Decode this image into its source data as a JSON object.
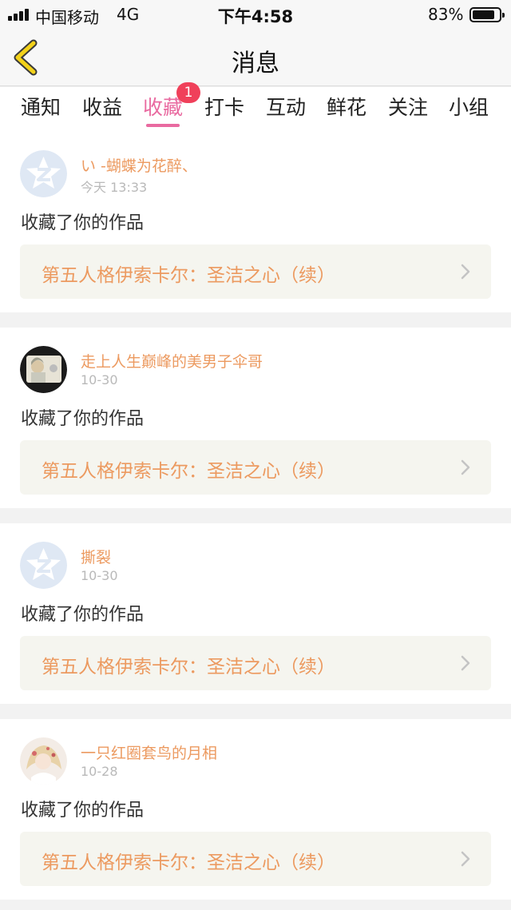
{
  "status_bar": {
    "carrier": "中国移动",
    "network": "4G",
    "time": "下午4:58",
    "battery_percent": "83%",
    "battery_level": 0.83
  },
  "nav": {
    "back_icon": "chevron-left-icon",
    "title": "消息"
  },
  "tabs": {
    "items": [
      {
        "label": "通知"
      },
      {
        "label": "收益"
      },
      {
        "label": "收藏",
        "badge": "1",
        "active": true
      },
      {
        "label": "打卡"
      },
      {
        "label": "互动"
      },
      {
        "label": "鲜花"
      },
      {
        "label": "关注"
      },
      {
        "label": "小组"
      }
    ]
  },
  "colors": {
    "accent_pink": "#e96aa0",
    "accent_orange": "#ec9a60",
    "badge_red": "#f0405a"
  },
  "feed": {
    "items": [
      {
        "username": "い -蝴蝶为花醉、",
        "time": "今天 13:33",
        "action": "收藏了你的作品",
        "work_title": "第五人格伊索卡尔：圣洁之心（续）",
        "avatar": "default-star-avatar"
      },
      {
        "username": "走上人生巅峰的美男子伞哥",
        "time": "10-30",
        "action": "收藏了你的作品",
        "work_title": "第五人格伊索卡尔：圣洁之心（续）",
        "avatar": "photo-avatar"
      },
      {
        "username": "撕裂",
        "time": "10-30",
        "action": "收藏了你的作品",
        "work_title": "第五人格伊索卡尔：圣洁之心（续）",
        "avatar": "default-star-avatar"
      },
      {
        "username": "一只红圈套鸟的月相",
        "time": "10-28",
        "action": "收藏了你的作品",
        "work_title": "第五人格伊索卡尔：圣洁之心（续）",
        "avatar": "anime-avatar"
      }
    ]
  }
}
